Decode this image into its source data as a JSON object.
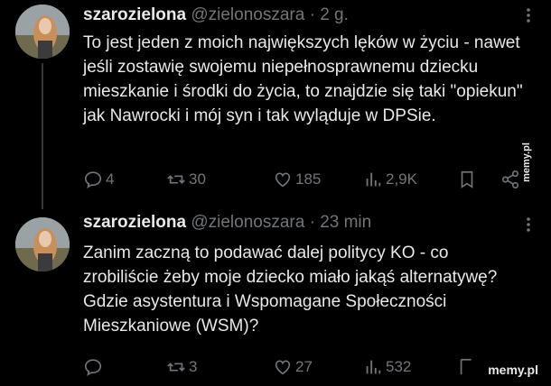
{
  "tweets": [
    {
      "name": "szarozielona",
      "handle": "@zielonoszara",
      "separator": "·",
      "time": "2 g.",
      "text": "To jest jeden z moich największych lęków w życiu - nawet jeśli zostawię swojemu niepełnosprawnemu dziecku mieszkanie i środki do życia, to znajdzie się taki \"opiekun\" jak Nawrocki i mój syn i tak wyląduje w DPSie.",
      "replies": "4",
      "reposts": "30",
      "likes": "185",
      "views": "2,9K"
    },
    {
      "name": "szarozielona",
      "handle": "@zielonoszara",
      "separator": "·",
      "time": "23 min",
      "text": "Zanim zaczną to podawać dalej politycy KO - co zrobiliście żeby moje dziecko miało jakąś alternatywę? Gdzie asystentura i Wspomagane Społeczności Mieszkaniowe (WSM)?",
      "replies": "",
      "reposts": "3",
      "likes": "27",
      "views": "532"
    }
  ],
  "watermark": "memy.pl"
}
